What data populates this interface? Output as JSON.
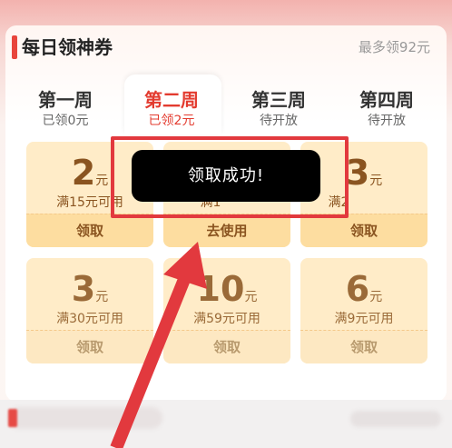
{
  "header": {
    "title": "每日领神券",
    "max_text": "最多领92元"
  },
  "weeks": [
    {
      "label": "第一周",
      "status": "已领0元"
    },
    {
      "label": "第二周",
      "status": "已领2元"
    },
    {
      "label": "第三周",
      "status": "待开放"
    },
    {
      "label": "第四周",
      "status": "待开放"
    }
  ],
  "coupons": [
    {
      "amount": "2",
      "unit": "元",
      "condition": "满15元可用",
      "button": "领取"
    },
    {
      "amount": "",
      "unit": "",
      "condition": "满1",
      "button": "去使用"
    },
    {
      "amount": "3",
      "unit": "元",
      "condition": "满2",
      "button": "领取"
    },
    {
      "amount": "3",
      "unit": "元",
      "condition": "满30元可用",
      "button": "领取"
    },
    {
      "amount": "10",
      "unit": "元",
      "condition": "满59元可用",
      "button": "领取"
    },
    {
      "amount": "6",
      "unit": "元",
      "condition": "满9元可用",
      "button": "领取"
    }
  ],
  "toast": {
    "text": "领取成功!"
  },
  "colors": {
    "accent": "#e33b2f",
    "annotation": "#e2393e",
    "coupon_bg": "#ffecc8",
    "coupon_text": "#8a5420"
  }
}
